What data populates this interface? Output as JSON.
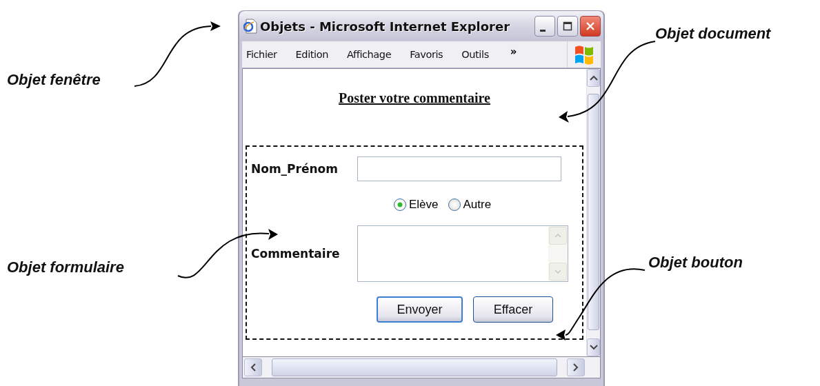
{
  "window": {
    "title": "Objets - Microsoft Internet Explorer"
  },
  "menu": {
    "items": [
      "Fichier",
      "Edition",
      "Affichage",
      "Favoris",
      "Outils"
    ],
    "overflow": "»"
  },
  "page": {
    "heading": "Poster votre commentaire",
    "form": {
      "fields": [
        {
          "kind": "text",
          "label": "Nom_Prénom"
        },
        {
          "kind": "radio_group",
          "options": [
            {
              "label": "Elève",
              "selected": true
            },
            {
              "label": "Autre",
              "selected": false
            }
          ]
        },
        {
          "kind": "textarea",
          "label": "Commentaire"
        }
      ],
      "buttons": [
        {
          "label": "Envoyer",
          "focused": true
        },
        {
          "label": "Effacer",
          "focused": false
        }
      ]
    }
  },
  "annotations": [
    "Objet document",
    "Objet fenêtre",
    "Objet formulaire",
    "Objet bouton"
  ]
}
